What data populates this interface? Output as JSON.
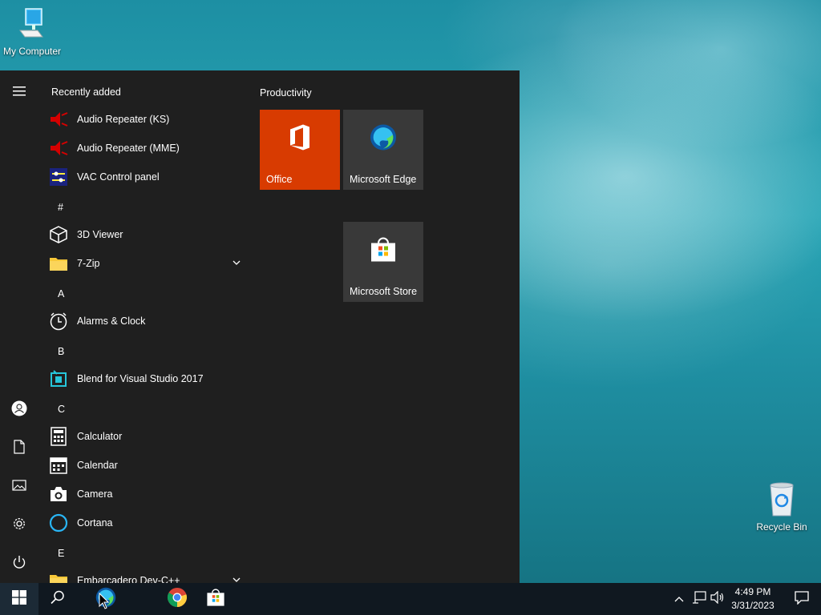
{
  "desktop": {
    "icons": [
      {
        "label": "My Computer",
        "icon": "computer-icon"
      },
      {
        "label": "Recycle Bin",
        "icon": "recycle-bin-icon"
      }
    ]
  },
  "start_menu": {
    "sections": {
      "recently_added": "Recently added",
      "hash": "#",
      "a": "A",
      "b": "B",
      "c": "C",
      "e": "E"
    },
    "apps": [
      {
        "label": "Audio Repeater (KS)",
        "icon": "audio-repeater-icon"
      },
      {
        "label": "Audio Repeater (MME)",
        "icon": "audio-repeater-icon"
      },
      {
        "label": "VAC Control panel",
        "icon": "vac-control-icon"
      },
      {
        "label": "3D Viewer",
        "icon": "cube-icon"
      },
      {
        "label": "7-Zip",
        "icon": "folder-icon"
      },
      {
        "label": "Alarms & Clock",
        "icon": "clock-icon"
      },
      {
        "label": "Blend for Visual Studio 2017",
        "icon": "blend-icon"
      },
      {
        "label": "Calculator",
        "icon": "calculator-icon"
      },
      {
        "label": "Calendar",
        "icon": "calendar-icon"
      },
      {
        "label": "Camera",
        "icon": "camera-icon"
      },
      {
        "label": "Cortana",
        "icon": "cortana-icon"
      },
      {
        "label": "Embarcadero Dev-C++",
        "icon": "folder-icon"
      }
    ],
    "tiles": {
      "group_title": "Productivity",
      "office": "Office",
      "edge": "Microsoft Edge",
      "store": "Microsoft Store"
    },
    "colors": {
      "office_tile": "#d83b01",
      "tile_bg": "#393939",
      "menu_bg": "#1f1f1f"
    }
  },
  "taskbar": {
    "pinned": [
      "start-icon",
      "search-icon",
      "edge-icon",
      "chrome-icon",
      "store-icon"
    ],
    "clock": {
      "time": "4:49 PM",
      "date": "3/31/2023"
    }
  }
}
